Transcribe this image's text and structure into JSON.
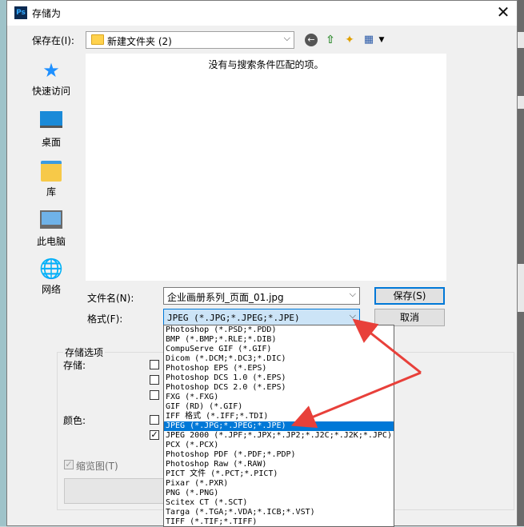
{
  "window": {
    "app_icon": "Ps",
    "title": "存储为",
    "close_label": "✕"
  },
  "toolbar": {
    "save_in_label": "保存在(I):",
    "current_folder": "新建文件夹 (2)",
    "icons": [
      "back-icon",
      "up-folder-icon",
      "new-folder-icon",
      "view-menu-icon"
    ]
  },
  "places": [
    {
      "label": "快速访问",
      "icon": "star-icon"
    },
    {
      "label": "桌面",
      "icon": "desktop-icon"
    },
    {
      "label": "库",
      "icon": "library-icon"
    },
    {
      "label": "此电脑",
      "icon": "computer-icon"
    },
    {
      "label": "网络",
      "icon": "network-icon"
    }
  ],
  "file_list": {
    "empty_message": "没有与搜索条件匹配的项。"
  },
  "form": {
    "filename_label": "文件名(N):",
    "filename_value": "企业画册系列_页面_01.jpg",
    "format_label": "格式(F):",
    "format_value": "JPEG (*.JPG;*.JPEG;*.JPE)",
    "save_button": "保存(S)",
    "cancel_button": "取消"
  },
  "options": {
    "section_title": "存储选项",
    "save_label": "存储:",
    "color_label": "颜色:",
    "thumbnail_label": "缩览图(T)",
    "thumbnail_checked": true,
    "color_checkbox_checked": true
  },
  "format_options": [
    "Photoshop (*.PSD;*.PDD)",
    "BMP (*.BMP;*.RLE;*.DIB)",
    "CompuServe GIF (*.GIF)",
    "Dicom (*.DCM;*.DC3;*.DIC)",
    "Photoshop EPS (*.EPS)",
    "Photoshop DCS 1.0 (*.EPS)",
    "Photoshop DCS 2.0 (*.EPS)",
    "FXG (*.FXG)",
    "GIF (RD) (*.GIF)",
    "IFF 格式 (*.IFF;*.TDI)",
    "JPEG (*.JPG;*.JPEG;*.JPE)",
    "JPEG 2000 (*.JPF;*.JPX;*.JP2;*.J2C;*.J2K;*.JPC)",
    "PCX (*.PCX)",
    "Photoshop PDF (*.PDF;*.PDP)",
    "Photoshop Raw (*.RAW)",
    "PICT 文件 (*.PCT;*.PICT)",
    "Pixar (*.PXR)",
    "PNG (*.PNG)",
    "Scitex CT (*.SCT)",
    "Targa (*.TGA;*.VDA;*.ICB;*.VST)",
    "TIFF (*.TIF;*.TIFF)"
  ],
  "selected_format_index": 10,
  "colors": {
    "accent": "#0078d7",
    "annotation_arrow": "#e8403a"
  }
}
